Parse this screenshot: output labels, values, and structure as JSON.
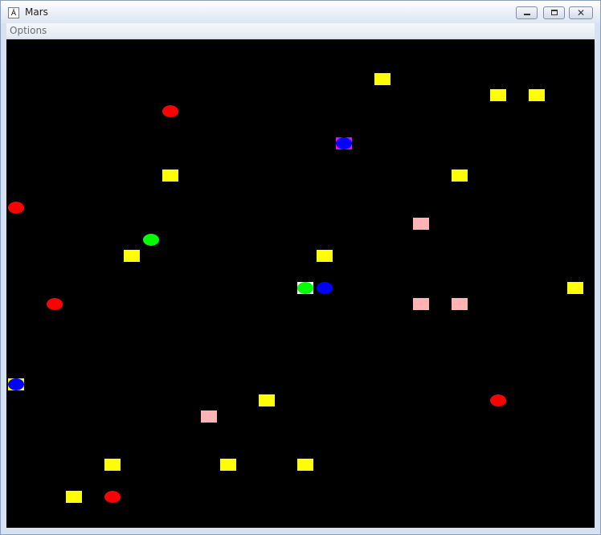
{
  "window": {
    "title": "Mars",
    "icon": "app-icon",
    "icon_glyph": "Ǎ",
    "controls": {
      "minimize": "minimize-icon",
      "maximize": "maximize-icon",
      "close": "close-icon",
      "close_glyph": "✕"
    }
  },
  "menu": {
    "items": [
      "Options"
    ]
  },
  "canvas": {
    "background": "#000000"
  },
  "colors": {
    "yellow": "#ffff00",
    "pink": "#ffb3b3",
    "red": "#ff0000",
    "green": "#00ff00",
    "blue": "#0000ff",
    "magenta": "#ff00ff",
    "white": "#ffffff"
  }
}
